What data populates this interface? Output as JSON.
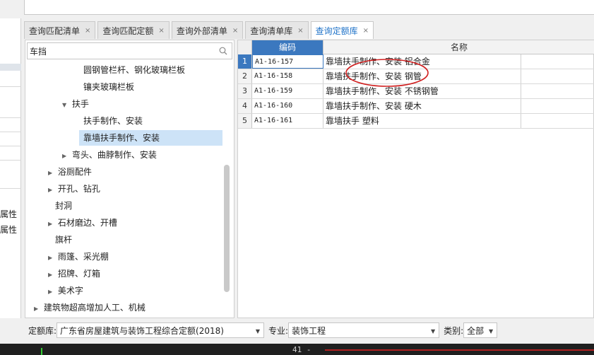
{
  "tabs": [
    {
      "label": "查询匹配清单",
      "close": "×"
    },
    {
      "label": "查询匹配定额",
      "close": "×"
    },
    {
      "label": "查询外部清单",
      "close": "×"
    },
    {
      "label": "查询清单库",
      "close": "×"
    },
    {
      "label": "查询定额库",
      "close": "×"
    }
  ],
  "left_col": {
    "labels": [
      "属性",
      "属性"
    ]
  },
  "search": {
    "value": "车挡",
    "icon": "search-icon"
  },
  "tree": [
    {
      "label": "圆钢管栏杆、钢化玻璃栏板",
      "arrow": ""
    },
    {
      "label": "镶夹玻璃栏板",
      "arrow": ""
    },
    {
      "label": "扶手",
      "arrow": "▼"
    },
    {
      "label": "扶手制作、安装",
      "arrow": ""
    },
    {
      "label": "靠墙扶手制作、安装",
      "arrow": ""
    },
    {
      "label": "弯头、曲脖制作、安装",
      "arrow": "▶"
    },
    {
      "label": "浴厕配件",
      "arrow": "▶"
    },
    {
      "label": "开孔、钻孔",
      "arrow": "▶"
    },
    {
      "label": "封洞",
      "arrow": ""
    },
    {
      "label": "石材磨边、开槽",
      "arrow": "▶"
    },
    {
      "label": "旗杆",
      "arrow": ""
    },
    {
      "label": "雨篷、采光棚",
      "arrow": "▶"
    },
    {
      "label": "招牌、灯箱",
      "arrow": "▶"
    },
    {
      "label": "美术字",
      "arrow": "▶"
    },
    {
      "label": "建筑物超高增加人工、机械",
      "arrow": "▶"
    }
  ],
  "grid": {
    "headers": {
      "code": "编码",
      "name": "名称"
    },
    "rows": [
      {
        "num": "1",
        "code": "A1-16-157",
        "name": "靠墙扶手制作、安装 铝合金"
      },
      {
        "num": "2",
        "code": "A1-16-158",
        "name": "靠墙扶手制作、安装 钢管"
      },
      {
        "num": "3",
        "code": "A1-16-159",
        "name": "靠墙扶手制作、安装 不锈钢管"
      },
      {
        "num": "4",
        "code": "A1-16-160",
        "name": "靠墙扶手制作、安装 硬木"
      },
      {
        "num": "5",
        "code": "A1-16-161",
        "name": "靠墙扶手 塑料"
      }
    ]
  },
  "bottom": {
    "quota_label": "定额库:",
    "quota_value": "广东省房屋建筑与装饰工程综合定额(2018)",
    "major_label": "专业:",
    "major_value": "装饰工程",
    "category_label": "类别:",
    "category_value": "全部"
  },
  "status": {
    "text": "41 -"
  },
  "colors": {
    "accent": "#3b78bf",
    "selected": "#cde3f7",
    "annotation": "#d02020"
  }
}
